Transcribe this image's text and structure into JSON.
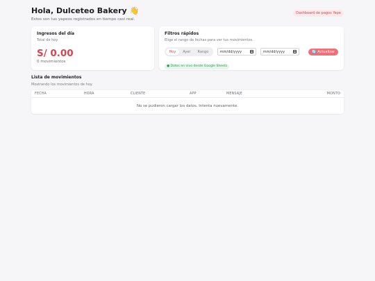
{
  "header": {
    "greeting": "Hola, Dulceteo Bakery 👋",
    "subtitle": "Estos son tus yapeos registrados en tiempo casi real.",
    "dashboard_pill": "Dashboard de pagos Yape"
  },
  "income_card": {
    "title": "Ingresos del día",
    "subtitle": "Total de hoy",
    "amount": "S/ 0.00",
    "movements": "0 movimientos"
  },
  "filters_card": {
    "title": "Filtros rápidos",
    "subtitle": "Elige el rango de fechas para ver tus movimientos.",
    "segments": [
      "Hoy",
      "Ayer",
      "Rango"
    ],
    "active_segment": "Hoy",
    "date_from_placeholder": "mm/dd/yyyy",
    "date_to_placeholder": "mm/dd/yyyy",
    "refresh_label": "Actualizar",
    "refresh_icon": "refresh-icon",
    "live_badge": "● Datos en vivo desde Google Sheets"
  },
  "list": {
    "title": "Lista de movimientos",
    "subtitle": "Mostrando los movimientos de hoy.",
    "columns": [
      "FECHA",
      "HORA",
      "CLIENTE",
      "APP",
      "MENSAJE",
      "MONTO"
    ],
    "empty_message": "No se pudieron cargar los datos. Intenta nuevamente."
  },
  "colors": {
    "accent": "#d94452",
    "button": "#ef6f78",
    "live": "#2b9a4f",
    "background": "#f6f6f8"
  }
}
